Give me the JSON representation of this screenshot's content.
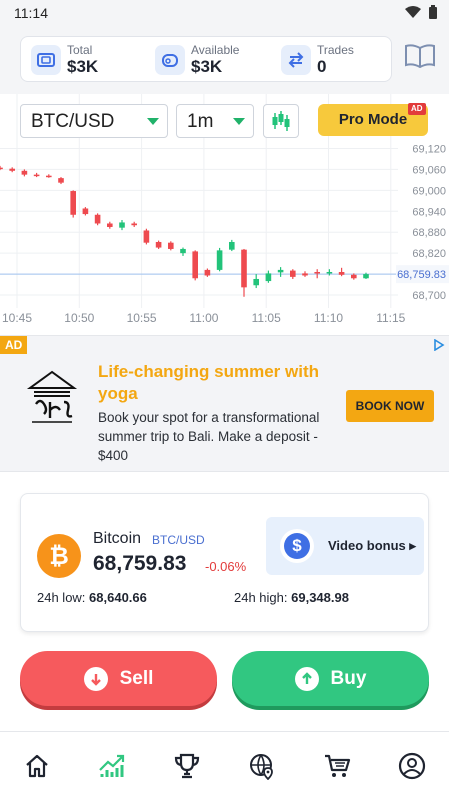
{
  "status_bar": {
    "time": "11:14"
  },
  "stats": [
    {
      "label": "Total",
      "value": "$3K",
      "icon": "wallet-icon"
    },
    {
      "label": "Available",
      "value": "$3K",
      "icon": "money-bag-icon"
    },
    {
      "label": "Trades",
      "value": "0",
      "icon": "transfer-arrows-icon"
    }
  ],
  "chart_controls": {
    "pair": "BTC/USD",
    "timeframe": "1m",
    "pro_mode_label": "Pro Mode",
    "ad_badge": "AD"
  },
  "chart_data": {
    "type": "candlestick",
    "x_ticks": [
      "10:45",
      "10:50",
      "10:55",
      "11:00",
      "11:05",
      "11:10",
      "11:15"
    ],
    "y_ticks": [
      69120,
      69060,
      69000,
      68940,
      68880,
      68820,
      68760,
      68700
    ],
    "y_tick_labels": [
      "69,120",
      "69,060",
      "69,000",
      "68,940",
      "68,880",
      "68,820",
      "68,760",
      "68,700"
    ],
    "current_price_label": "68,759.83",
    "current_price": 68759.83,
    "ylim": [
      68680,
      69150
    ],
    "colors": {
      "up": "#22c37a",
      "down": "#ee4a4f",
      "price_line": "#9fc2ef"
    },
    "candles": [
      {
        "o": 69065,
        "h": 69070,
        "l": 69058,
        "c": 69062
      },
      {
        "o": 69062,
        "h": 69066,
        "l": 69052,
        "c": 69056
      },
      {
        "o": 69056,
        "h": 69060,
        "l": 69040,
        "c": 69045
      },
      {
        "o": 69045,
        "h": 69050,
        "l": 69038,
        "c": 69042
      },
      {
        "o": 69042,
        "h": 69046,
        "l": 69036,
        "c": 69038
      },
      {
        "o": 69035,
        "h": 69038,
        "l": 69018,
        "c": 69022
      },
      {
        "o": 68998,
        "h": 69000,
        "l": 68922,
        "c": 68930
      },
      {
        "o": 68948,
        "h": 68952,
        "l": 68928,
        "c": 68932
      },
      {
        "o": 68930,
        "h": 68934,
        "l": 68900,
        "c": 68905
      },
      {
        "o": 68905,
        "h": 68910,
        "l": 68890,
        "c": 68895
      },
      {
        "o": 68893,
        "h": 68915,
        "l": 68886,
        "c": 68908
      },
      {
        "o": 68905,
        "h": 68910,
        "l": 68895,
        "c": 68900
      },
      {
        "o": 68885,
        "h": 68890,
        "l": 68845,
        "c": 68850
      },
      {
        "o": 68852,
        "h": 68856,
        "l": 68832,
        "c": 68836
      },
      {
        "o": 68850,
        "h": 68854,
        "l": 68828,
        "c": 68832
      },
      {
        "o": 68820,
        "h": 68836,
        "l": 68812,
        "c": 68832
      },
      {
        "o": 68825,
        "h": 68828,
        "l": 68742,
        "c": 68748
      },
      {
        "o": 68772,
        "h": 68776,
        "l": 68752,
        "c": 68756
      },
      {
        "o": 68772,
        "h": 68835,
        "l": 68768,
        "c": 68828
      },
      {
        "o": 68830,
        "h": 68858,
        "l": 68826,
        "c": 68852
      },
      {
        "o": 68830,
        "h": 68832,
        "l": 68695,
        "c": 68722
      },
      {
        "o": 68728,
        "h": 68760,
        "l": 68720,
        "c": 68746
      },
      {
        "o": 68740,
        "h": 68770,
        "l": 68735,
        "c": 68762
      },
      {
        "o": 68765,
        "h": 68780,
        "l": 68752,
        "c": 68772
      },
      {
        "o": 68770,
        "h": 68774,
        "l": 68746,
        "c": 68752
      },
      {
        "o": 68762,
        "h": 68768,
        "l": 68752,
        "c": 68756
      },
      {
        "o": 68766,
        "h": 68774,
        "l": 68748,
        "c": 68762
      },
      {
        "o": 68762,
        "h": 68774,
        "l": 68756,
        "c": 68766
      },
      {
        "o": 68766,
        "h": 68778,
        "l": 68754,
        "c": 68758
      },
      {
        "o": 68758,
        "h": 68762,
        "l": 68744,
        "c": 68748
      },
      {
        "o": 68748,
        "h": 68764,
        "l": 68746,
        "c": 68760
      }
    ]
  },
  "ad": {
    "tag": "AD",
    "title": "Life-changing summer with yoga",
    "body": "Book your spot for a transformational summer trip to Bali. Make a deposit - $400",
    "cta": "BOOK NOW"
  },
  "asset": {
    "name": "Bitcoin",
    "pair": "BTC/USD",
    "price": "68,759.83",
    "change": "-0.06%",
    "low_label": "24h low:",
    "low_value": "68,640.66",
    "high_label": "24h high:",
    "high_value": "69,348.98",
    "video_bonus": "Video bonus ▸"
  },
  "actions": {
    "sell": "Sell",
    "buy": "Buy"
  },
  "nav": [
    {
      "icon": "home-icon"
    },
    {
      "icon": "trading-chart-icon"
    },
    {
      "icon": "trophy-icon"
    },
    {
      "icon": "globe-pin-icon"
    },
    {
      "icon": "cart-icon"
    },
    {
      "icon": "profile-icon"
    }
  ]
}
